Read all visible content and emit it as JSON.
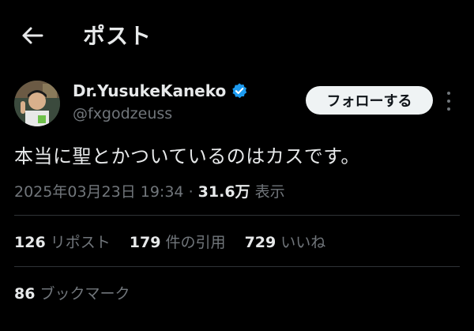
{
  "header": {
    "title": "ポスト",
    "back_icon": "arrow-left-icon"
  },
  "author": {
    "name": "Dr.YusukeKaneko",
    "handle": "@fxgodzeuss",
    "verified_color": "#1d9bf0",
    "verified_icon": "verified-badge-icon"
  },
  "follow_label": "フォローする",
  "more_icon": "more-vertical-icon",
  "tweet": {
    "text": "本当に聖とかついているのはカスです。"
  },
  "meta": {
    "timestamp": "2025年03月23日 19:34",
    "separator": "·",
    "views_count": "31.6万",
    "views_label": "表示"
  },
  "stats": {
    "reposts": {
      "count": "126",
      "label": "リポスト"
    },
    "quotes": {
      "count": "179",
      "label": "件の引用"
    },
    "likes": {
      "count": "729",
      "label": "いいね"
    }
  },
  "bookmarks": {
    "count": "86",
    "label": "ブックマーク"
  }
}
